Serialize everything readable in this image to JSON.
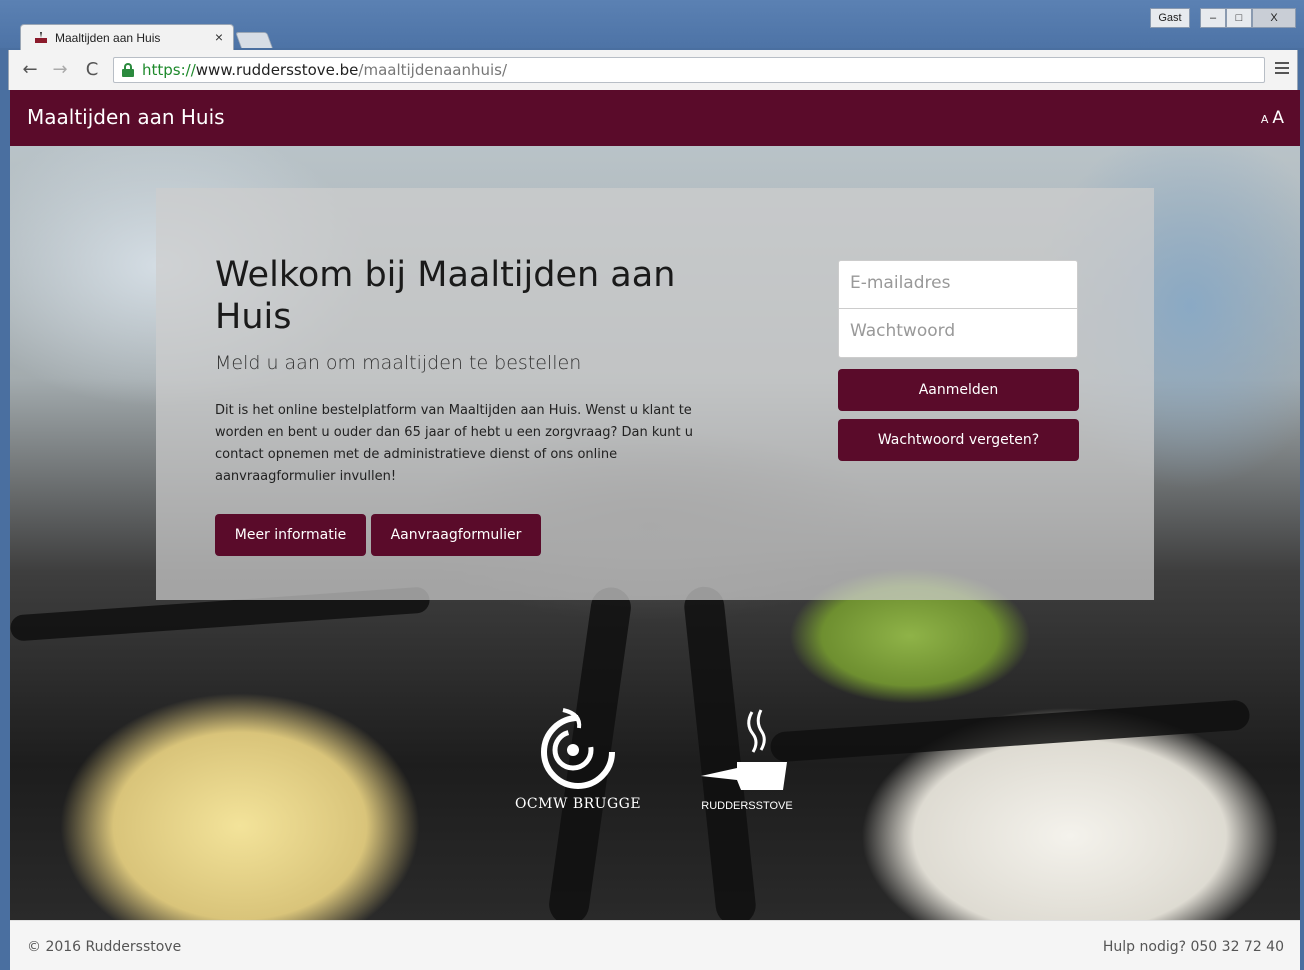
{
  "browser": {
    "tab_title": "Maaltijden aan Huis",
    "tab_close": "×",
    "user_label": "Gast",
    "minimize": "–",
    "maximize": "□",
    "close": "X",
    "url_scheme": "https://",
    "url_host": "www.ruddersstove.be",
    "url_path": "/maaltijdenaanhuis/",
    "back": "←",
    "forward": "→",
    "reload": "C"
  },
  "header": {
    "title": "Maaltijden aan Huis",
    "font_small": "A",
    "font_large": "A",
    "color": "#5a0b2a"
  },
  "intro": {
    "title": "Welkom bij Maaltijden aan Huis",
    "subtitle": "Meld u aan om maaltijden te bestellen",
    "body": "Dit is het online bestelplatform van Maaltijden aan Huis. Wenst u klant te worden en bent u ouder dan 65 jaar of hebt u een zorgvraag? Dan kunt u contact opnemen met de administratieve dienst of ons online aanvraagformulier invullen!",
    "info_button": "Meer informatie",
    "form_button": "Aanvraagformulier"
  },
  "login": {
    "email_placeholder": "E-mailadres",
    "password_placeholder": "Wachtwoord",
    "login_button": "Aanmelden",
    "forgot_button": "Wachtwoord vergeten?"
  },
  "logos": {
    "ocmw": "OCMW BRUGGE",
    "rudd": "RUDDERSSTOVE"
  },
  "footer": {
    "copyright": "© 2016 Ruddersstove",
    "help": "Hulp nodig? 050 32 72 40"
  }
}
